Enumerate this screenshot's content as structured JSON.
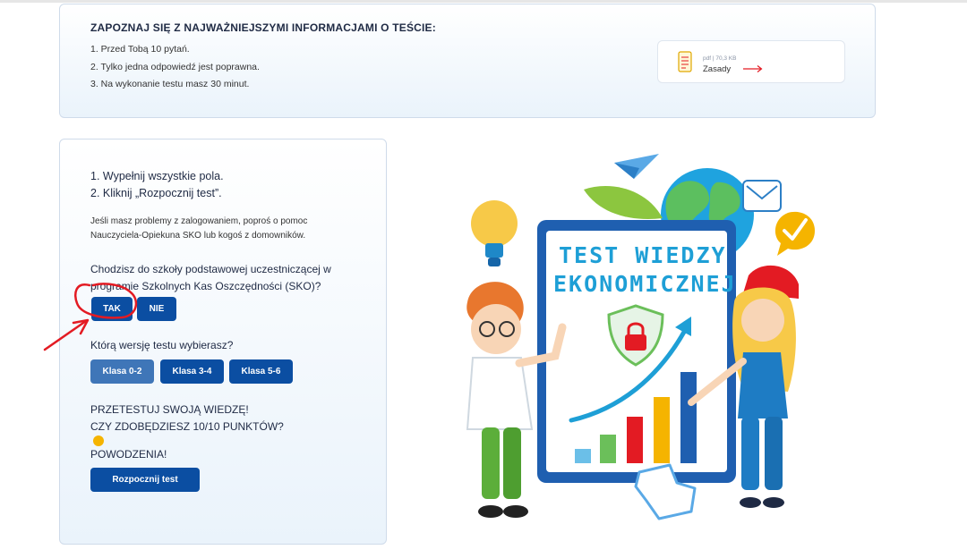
{
  "info": {
    "title": "ZAPOZNAJ SIĘ Z NAJWAŻNIEJSZYMI INFORMACJAMI O TEŚCIE:",
    "items": [
      "1. Przed Tobą 10 pytań.",
      "2. Tylko jedna odpowiedź jest poprawna.",
      "3. Na wykonanie testu masz 30 minut."
    ],
    "file": {
      "meta": "pdf | 70,3 KB",
      "name": "Zasady",
      "icon": "document-icon"
    }
  },
  "form": {
    "steps": [
      "1. Wypełnij wszystkie pola.",
      "2. Kliknij „Rozpocznij test”."
    ],
    "help": "Jeśli masz problemy z zalogowaniem, poproś o pomoc Nauczyciela-Opiekuna SKO lub kogoś z domowników.",
    "question_sko": "Chodzisz do szkoły podstawowej uczestniczącej w programie Szkolnych Kas Oszczędności (SKO)?",
    "yes_label": "TAK",
    "no_label": "NIE",
    "question_version": "Którą wersję testu wybierasz?",
    "versions": [
      "Klasa 0-2",
      "Klasa 3-4",
      "Klasa 5-6"
    ],
    "motto": [
      "PRZETESTUJ SWOJĄ WIEDZĘ!",
      "CZY ZDOBĘDZIESZ 10/10 PUNKTÓW?",
      "POWODZENIA!"
    ],
    "start_label": "Rozpocznij test"
  },
  "illustration": {
    "headline": [
      "TEST WIEDZY",
      "EKONOMICZNEJ"
    ]
  },
  "colors": {
    "primary": "#0b4ea2",
    "primary_light": "#3f76b8",
    "annotation": "#e31b23",
    "headline": "#1e9fd6"
  }
}
